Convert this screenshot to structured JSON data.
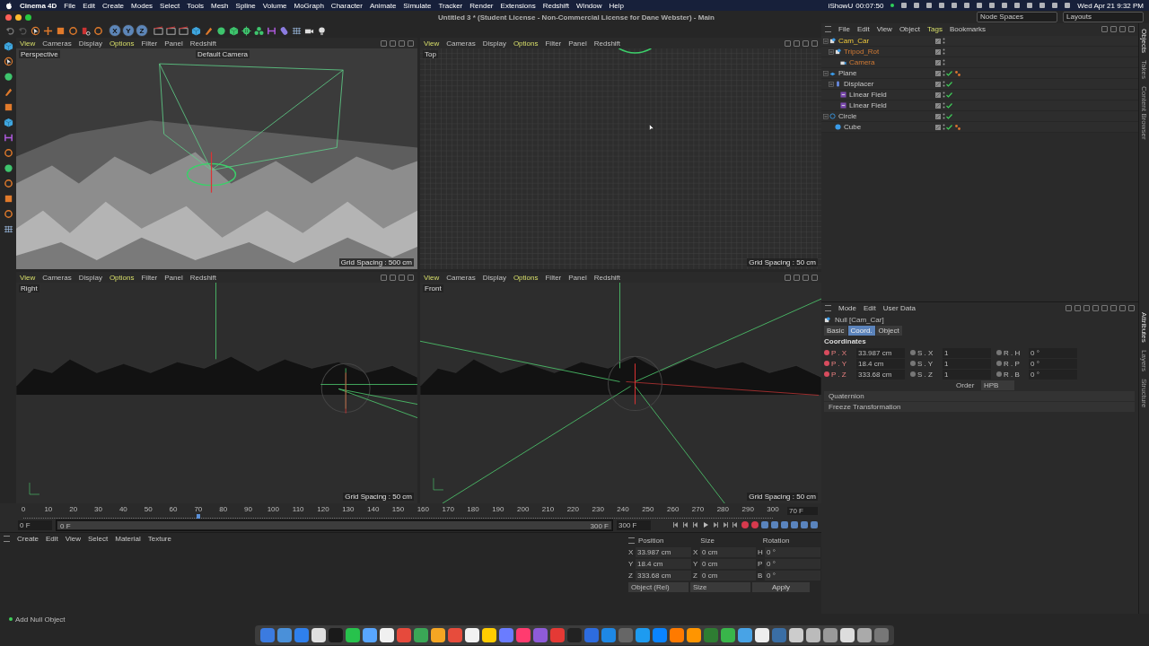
{
  "menu_bar": {
    "app": "Cinema 4D",
    "items": [
      "File",
      "Edit",
      "Create",
      "Modes",
      "Select",
      "Tools",
      "Mesh",
      "Spline",
      "Volume",
      "MoGraph",
      "Character",
      "Animate",
      "Simulate",
      "Tracker",
      "Render",
      "Extensions",
      "Redshift",
      "Window",
      "Help"
    ],
    "recorder": "iShowU",
    "recorder_time": "00:07:50",
    "clock": "Wed Apr 21  9:32 PM"
  },
  "window": {
    "title": "Untitled 3 * (Student License - Non-Commercial License for Dane Webster) - Main",
    "node_spaces": "Node Spaces",
    "layouts": "Layouts"
  },
  "toolbar": {
    "axis_buttons": [
      "X",
      "Y",
      "Z"
    ]
  },
  "viewports": [
    {
      "kind": "perspective",
      "label": "Perspective",
      "camera": "Default Camera",
      "grid_spacing": "Grid Spacing : 500 cm",
      "menu": [
        {
          "label": "View",
          "highlighted": true
        },
        {
          "label": "Cameras",
          "highlighted": false
        },
        {
          "label": "Display",
          "highlighted": false
        },
        {
          "label": "Options",
          "highlighted": true
        },
        {
          "label": "Filter",
          "highlighted": false
        },
        {
          "label": "Panel",
          "highlighted": false
        },
        {
          "label": "Redshift",
          "highlighted": false
        }
      ]
    },
    {
      "kind": "top",
      "label": "Top",
      "grid_spacing": "Grid Spacing : 50 cm",
      "menu": [
        {
          "label": "View",
          "highlighted": true
        },
        {
          "label": "Cameras",
          "highlighted": false
        },
        {
          "label": "Display",
          "highlighted": false
        },
        {
          "label": "Options",
          "highlighted": true
        },
        {
          "label": "Filter",
          "highlighted": false
        },
        {
          "label": "Panel",
          "highlighted": false
        },
        {
          "label": "Redshift",
          "highlighted": false
        }
      ]
    },
    {
      "kind": "right",
      "label": "Right",
      "grid_spacing": "Grid Spacing : 50 cm",
      "menu": [
        {
          "label": "View",
          "highlighted": true
        },
        {
          "label": "Cameras",
          "highlighted": false
        },
        {
          "label": "Display",
          "highlighted": false
        },
        {
          "label": "Options",
          "highlighted": true
        },
        {
          "label": "Filter",
          "highlighted": false
        },
        {
          "label": "Panel",
          "highlighted": false
        },
        {
          "label": "Redshift",
          "highlighted": false
        }
      ]
    },
    {
      "kind": "front",
      "label": "Front",
      "grid_spacing": "Grid Spacing : 50 cm",
      "menu": [
        {
          "label": "View",
          "highlighted": true
        },
        {
          "label": "Cameras",
          "highlighted": false
        },
        {
          "label": "Display",
          "highlighted": false
        },
        {
          "label": "Options",
          "highlighted": true
        },
        {
          "label": "Filter",
          "highlighted": false
        },
        {
          "label": "Panel",
          "highlighted": false
        },
        {
          "label": "Redshift",
          "highlighted": false
        }
      ]
    }
  ],
  "timeline": {
    "ticks": [
      "0",
      "10",
      "20",
      "30",
      "40",
      "50",
      "60",
      "70",
      "80",
      "90",
      "100",
      "110",
      "120",
      "130",
      "140",
      "150",
      "160",
      "170",
      "180",
      "190",
      "200",
      "210",
      "220",
      "230",
      "240",
      "250",
      "260",
      "270",
      "280",
      "290",
      "300"
    ],
    "playhead": {
      "level": 0.233
    },
    "range": {
      "level": 1
    },
    "current_frame": "70 F",
    "start": "0 F",
    "range_start": "0 F",
    "range_end": "300 F",
    "end": "300 F"
  },
  "material_manager": {
    "menu": [
      "Create",
      "Edit",
      "View",
      "Select",
      "Material",
      "Texture"
    ]
  },
  "coordinates": {
    "headers": [
      "Position",
      "Size",
      "Rotation"
    ],
    "rows": [
      {
        "axis": "X",
        "position": "33.987 cm",
        "size_axis": "X",
        "size": "0 cm",
        "rotation_axis": "H",
        "rotation": "0 °"
      },
      {
        "axis": "Y",
        "position": "18.4 cm",
        "size_axis": "Y",
        "size": "0 cm",
        "rotation_axis": "P",
        "rotation": "0 °"
      },
      {
        "axis": "Z",
        "position": "333.68 cm",
        "size_axis": "Z",
        "size": "0 cm",
        "rotation_axis": "B",
        "rotation": "0 °"
      }
    ],
    "mode": "Object (Rel)",
    "size_mode": "Size",
    "apply": "Apply"
  },
  "status_bar": "Add Null Object",
  "object_manager": {
    "menu": [
      {
        "label": "File",
        "highlighted": false
      },
      {
        "label": "Edit",
        "highlighted": false
      },
      {
        "label": "View",
        "highlighted": false
      },
      {
        "label": "Object",
        "highlighted": false
      },
      {
        "label": "Tags",
        "highlighted": true
      },
      {
        "label": "Bookmarks",
        "highlighted": false
      }
    ],
    "tree": [
      {
        "name": "Cam_Car",
        "kind": "null",
        "selected": true,
        "expanded": true,
        "checked": false,
        "has_tag": false,
        "children": [
          {
            "name": "Tripod_Rot",
            "kind": "null",
            "selected": false,
            "expanded": true,
            "checked": false,
            "has_tag": false,
            "children": [
              {
                "name": "Camera",
                "kind": "camera",
                "selected": false,
                "checked": false,
                "has_tag": false
              }
            ]
          }
        ]
      },
      {
        "name": "Plane",
        "kind": "plane",
        "selected": false,
        "expanded": true,
        "checked": true,
        "has_tag": true,
        "children": [
          {
            "name": "Displacer",
            "kind": "deformer",
            "selected": false,
            "expanded": true,
            "checked": true,
            "has_tag": false,
            "children": [
              {
                "name": "Linear Field",
                "kind": "field",
                "selected": false,
                "checked": true,
                "has_tag": false
              },
              {
                "name": "Linear Field",
                "kind": "field",
                "selected": false,
                "checked": true,
                "has_tag": false
              }
            ]
          }
        ]
      },
      {
        "name": "Circle",
        "kind": "spline",
        "selected": false,
        "expanded": true,
        "checked": true,
        "has_tag": false,
        "children": [
          {
            "name": "Cube",
            "kind": "cube",
            "selected": false,
            "checked": true,
            "has_tag": true
          }
        ]
      }
    ],
    "side_tabs": [
      "Objects",
      "Takes",
      "Content Browser"
    ]
  },
  "attributes": {
    "menu": [
      "Mode",
      "Edit",
      "User Data"
    ],
    "object": "Null [Cam_Car]",
    "tabs": [
      {
        "label": "Basic",
        "selected": false
      },
      {
        "label": "Coord.",
        "selected": true
      },
      {
        "label": "Object",
        "selected": false
      }
    ],
    "section": "Coordinates",
    "rows": [
      {
        "p_label": "P . X",
        "p": "33.987 cm",
        "s_label": "S . X",
        "s": "1",
        "r_label": "R . H",
        "r": "0 °"
      },
      {
        "p_label": "P . Y",
        "p": "18.4 cm",
        "s_label": "S . Y",
        "s": "1",
        "r_label": "R . P",
        "r": "0 °"
      },
      {
        "p_label": "P . Z",
        "p": "333.68 cm",
        "s_label": "S . Z",
        "s": "1",
        "r_label": "R . B",
        "r": "0 °"
      }
    ],
    "order_label": "Order",
    "order": "HPB",
    "groups": [
      "Quaternion",
      "Freeze Transformation"
    ],
    "side_tabs": [
      "Attributes",
      "Layers",
      "Structure"
    ]
  }
}
